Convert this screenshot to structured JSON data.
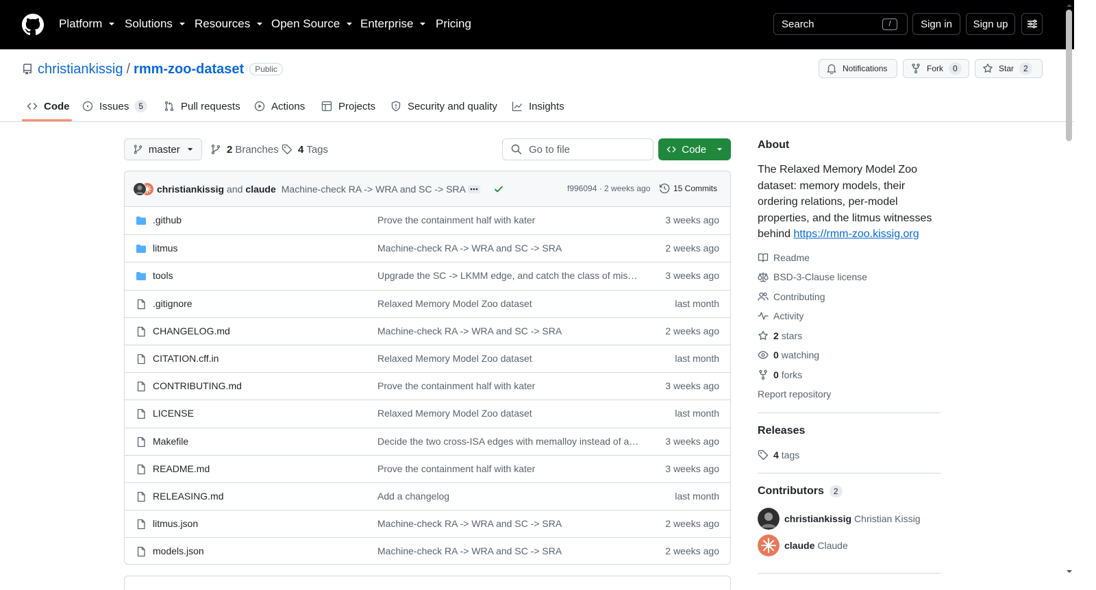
{
  "header": {
    "nav": [
      "Platform",
      "Solutions",
      "Resources",
      "Open Source",
      "Enterprise",
      "Pricing"
    ],
    "search_label": "Search",
    "search_key": "/",
    "sign_in": "Sign in",
    "sign_up": "Sign up"
  },
  "repo": {
    "owner": "christiankissig",
    "separator": "/",
    "name": "rmm-zoo-dataset",
    "visibility": "Public",
    "notifications_label": "Notifications",
    "fork_label": "Fork",
    "fork_count": "0",
    "star_label": "Star",
    "star_count": "2"
  },
  "tabs": [
    {
      "label": "Code",
      "icon": "code-icon"
    },
    {
      "label": "Issues",
      "icon": "issue-icon",
      "count": "5"
    },
    {
      "label": "Pull requests",
      "icon": "pull-request-icon"
    },
    {
      "label": "Actions",
      "icon": "play-icon"
    },
    {
      "label": "Projects",
      "icon": "table-icon"
    },
    {
      "label": "Security and quality",
      "icon": "shield-icon"
    },
    {
      "label": "Insights",
      "icon": "graph-icon"
    }
  ],
  "toolbar": {
    "branch": "master",
    "branches_count": "2",
    "branches_label": "Branches",
    "tags_count": "4",
    "tags_label": "Tags",
    "go_to_file_placeholder": "Go to file",
    "code_button": "Code"
  },
  "latest_commit": {
    "author": "christiankissig",
    "and": "and",
    "coauthor": "claude",
    "message": "Machine-check RA -> WRA and SC -> SRA",
    "sha_and_time": "f996094 · 2 weeks ago",
    "commits_label": "15 Commits"
  },
  "files": [
    {
      "name": ".github",
      "type": "dir",
      "message": "Prove the containment half with kater",
      "date": "3 weeks ago"
    },
    {
      "name": "litmus",
      "type": "dir",
      "message": "Machine-check RA -> WRA and SC -> SRA",
      "date": "2 weeks ago"
    },
    {
      "name": "tools",
      "type": "dir",
      "message": "Upgrade the SC -> LKMM edge, and catch the class of miss…",
      "date": "3 weeks ago"
    },
    {
      "name": ".gitignore",
      "type": "file",
      "message": "Relaxed Memory Model Zoo dataset",
      "date": "last month"
    },
    {
      "name": "CHANGELOG.md",
      "type": "file",
      "message": "Machine-check RA -> WRA and SC -> SRA",
      "date": "2 weeks ago"
    },
    {
      "name": "CITATION.cff.in",
      "type": "file",
      "message": "Relaxed Memory Model Zoo dataset",
      "date": "last month"
    },
    {
      "name": "CONTRIBUTING.md",
      "type": "file",
      "message": "Prove the containment half with kater",
      "date": "3 weeks ago"
    },
    {
      "name": "LICENSE",
      "type": "file",
      "message": "Relaxed Memory Model Zoo dataset",
      "date": "last month"
    },
    {
      "name": "Makefile",
      "type": "file",
      "message": "Decide the two cross-ISA edges with memalloy instead of ar…",
      "date": "3 weeks ago"
    },
    {
      "name": "README.md",
      "type": "file",
      "message": "Prove the containment half with kater",
      "date": "3 weeks ago"
    },
    {
      "name": "RELEASING.md",
      "type": "file",
      "message": "Add a changelog",
      "date": "last month"
    },
    {
      "name": "litmus.json",
      "type": "file",
      "message": "Machine-check RA -> WRA and SC -> SRA",
      "date": "2 weeks ago"
    },
    {
      "name": "models.json",
      "type": "file",
      "message": "Machine-check RA -> WRA and SC -> SRA",
      "date": "2 weeks ago"
    }
  ],
  "sidebar": {
    "about_heading": "About",
    "description": "The Relaxed Memory Model Zoo dataset: memory models, their ordering relations, per-model properties, and the litmus witnesses behind",
    "website": "https://rmm-zoo.kissig.org",
    "links": [
      {
        "label": "Readme",
        "icon": "book-icon"
      },
      {
        "label": "BSD-3-Clause license",
        "icon": "law-icon"
      },
      {
        "label": "Contributing",
        "icon": "people-icon"
      },
      {
        "label": "Activity",
        "icon": "pulse-icon"
      }
    ],
    "stars_count": "2",
    "stars_label": "stars",
    "watching_count": "0",
    "watching_label": "watching",
    "forks_count": "0",
    "forks_label": "forks",
    "report": "Report repository",
    "releases_heading": "Releases",
    "tags_count": "4",
    "tags_label": "tags",
    "contributors_heading": "Contributors",
    "contributors_count": "2",
    "contributors": [
      {
        "login": "christiankissig",
        "name": "Christian Kissig"
      },
      {
        "login": "claude",
        "name": "Claude"
      }
    ]
  },
  "colors": {
    "header_bg": "#000000",
    "link": "#0969da",
    "code_button": "#1f883d",
    "active_tab_underline": "#fd8c73",
    "folder_icon": "#54aeff"
  }
}
